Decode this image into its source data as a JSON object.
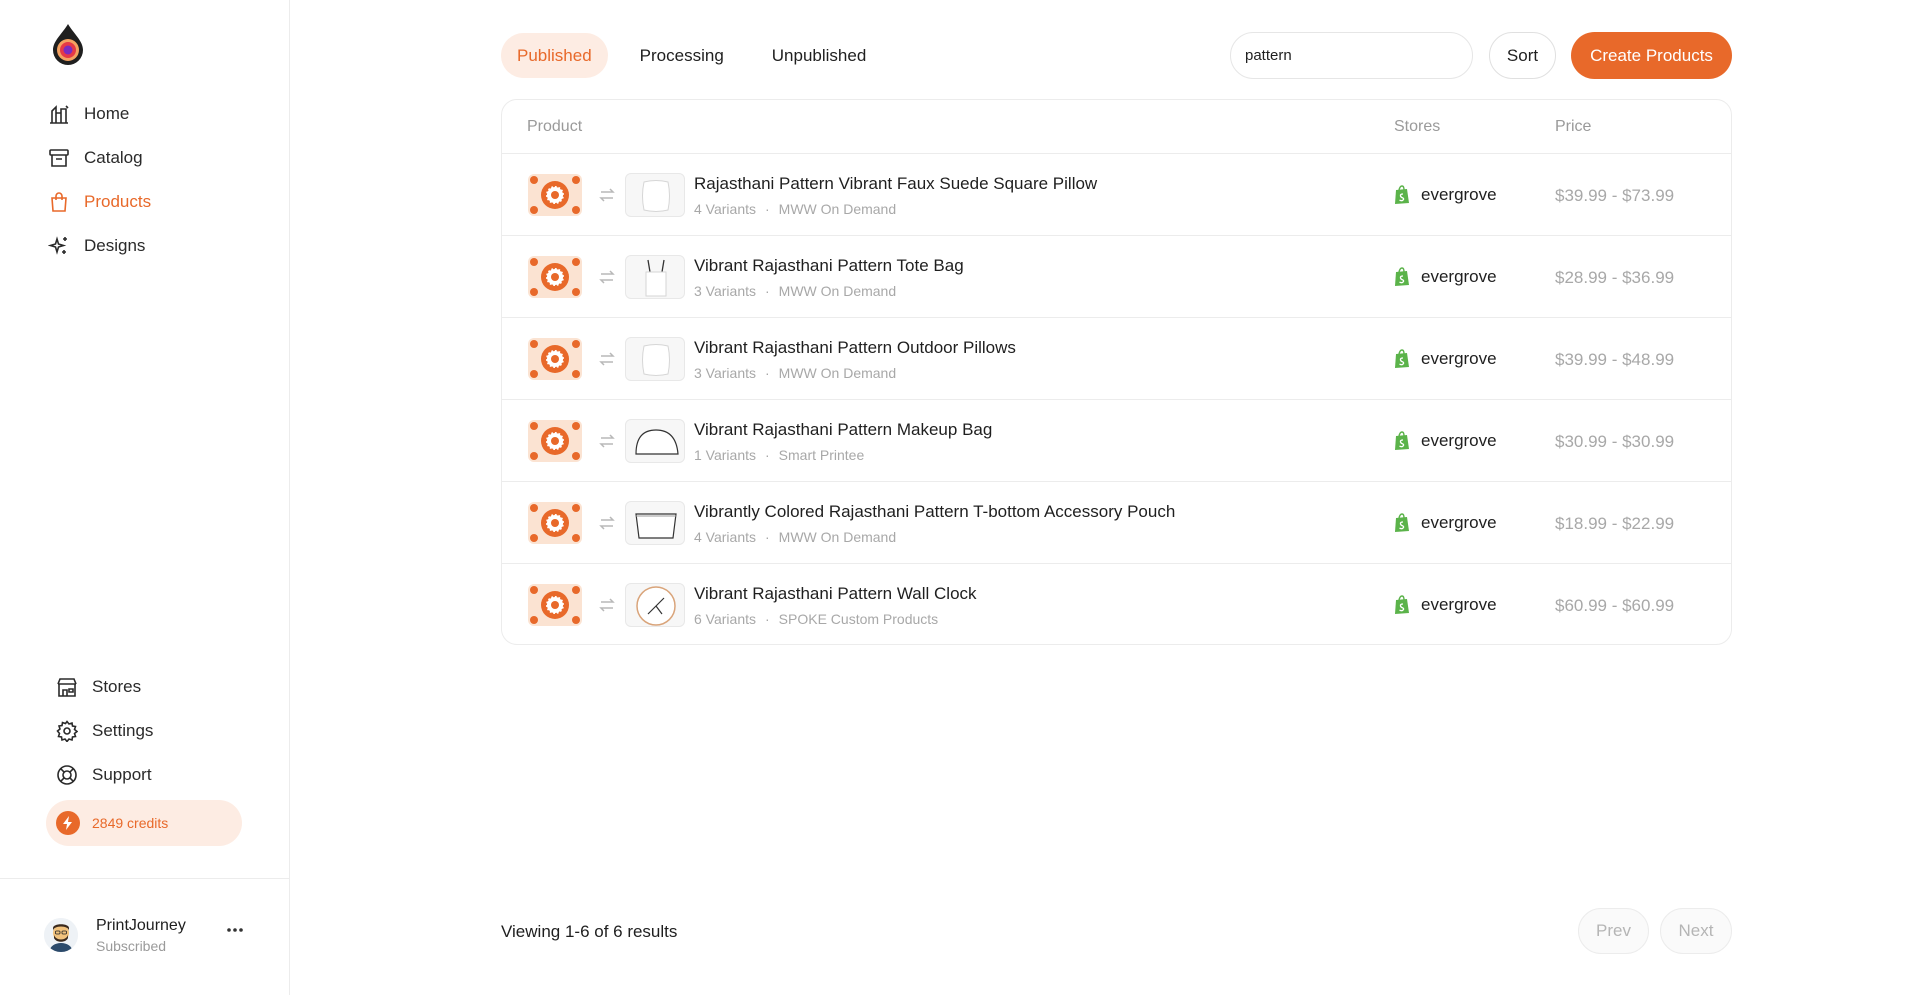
{
  "colors": {
    "accent": "#e8692a",
    "accent_soft": "#fdece3",
    "muted": "#a8a8a8",
    "shopify_green": "#5bb34a"
  },
  "sidebar": {
    "logo_icon": "drop-logo-icon",
    "nav": [
      {
        "label": "Home",
        "icon": "home-chart-icon",
        "active": false
      },
      {
        "label": "Catalog",
        "icon": "archive-icon",
        "active": false
      },
      {
        "label": "Products",
        "icon": "shopping-bag-icon",
        "active": true
      },
      {
        "label": "Designs",
        "icon": "sparkles-icon",
        "active": false
      }
    ],
    "bottom_nav": [
      {
        "label": "Stores",
        "icon": "storefront-icon"
      },
      {
        "label": "Settings",
        "icon": "gear-icon"
      },
      {
        "label": "Support",
        "icon": "lifebuoy-icon"
      }
    ],
    "credits": "2849 credits",
    "user": {
      "name": "PrintJourney",
      "status": "Subscribed"
    }
  },
  "toolbar": {
    "tabs": [
      {
        "label": "Published",
        "active": true
      },
      {
        "label": "Processing",
        "active": false
      },
      {
        "label": "Unpublished",
        "active": false
      }
    ],
    "search_value": "pattern",
    "sort_label": "Sort",
    "create_label": "Create Products"
  },
  "table": {
    "headers": {
      "product": "Product",
      "stores": "Stores",
      "price": "Price"
    },
    "rows": [
      {
        "title": "Rajasthani Pattern Vibrant Faux Suede Square Pillow",
        "variants": "4 Variants",
        "provider": "MWW On Demand",
        "store": "evergrove",
        "price": "$39.99 - $73.99",
        "product_icon": "pillow-icon"
      },
      {
        "title": "Vibrant Rajasthani Pattern Tote Bag",
        "variants": "3 Variants",
        "provider": "MWW On Demand",
        "store": "evergrove",
        "price": "$28.99 - $36.99",
        "product_icon": "tote-bag-icon"
      },
      {
        "title": "Vibrant Rajasthani Pattern Outdoor Pillows",
        "variants": "3 Variants",
        "provider": "MWW On Demand",
        "store": "evergrove",
        "price": "$39.99 - $48.99",
        "product_icon": "pillow-icon"
      },
      {
        "title": "Vibrant Rajasthani Pattern Makeup Bag",
        "variants": "1 Variants",
        "provider": "Smart Printee",
        "store": "evergrove",
        "price": "$30.99 - $30.99",
        "product_icon": "makeup-bag-icon"
      },
      {
        "title": "Vibrantly Colored Rajasthani Pattern T-bottom Accessory Pouch",
        "variants": "4 Variants",
        "provider": "MWW On Demand",
        "store": "evergrove",
        "price": "$18.99 - $22.99",
        "product_icon": "pouch-icon"
      },
      {
        "title": "Vibrant Rajasthani Pattern Wall Clock",
        "variants": "6 Variants",
        "provider": "SPOKE Custom Products",
        "store": "evergrove",
        "price": "$60.99 - $60.99",
        "product_icon": "wall-clock-icon"
      }
    ]
  },
  "footer": {
    "results": "Viewing 1-6 of 6 results",
    "prev": "Prev",
    "next": "Next"
  }
}
